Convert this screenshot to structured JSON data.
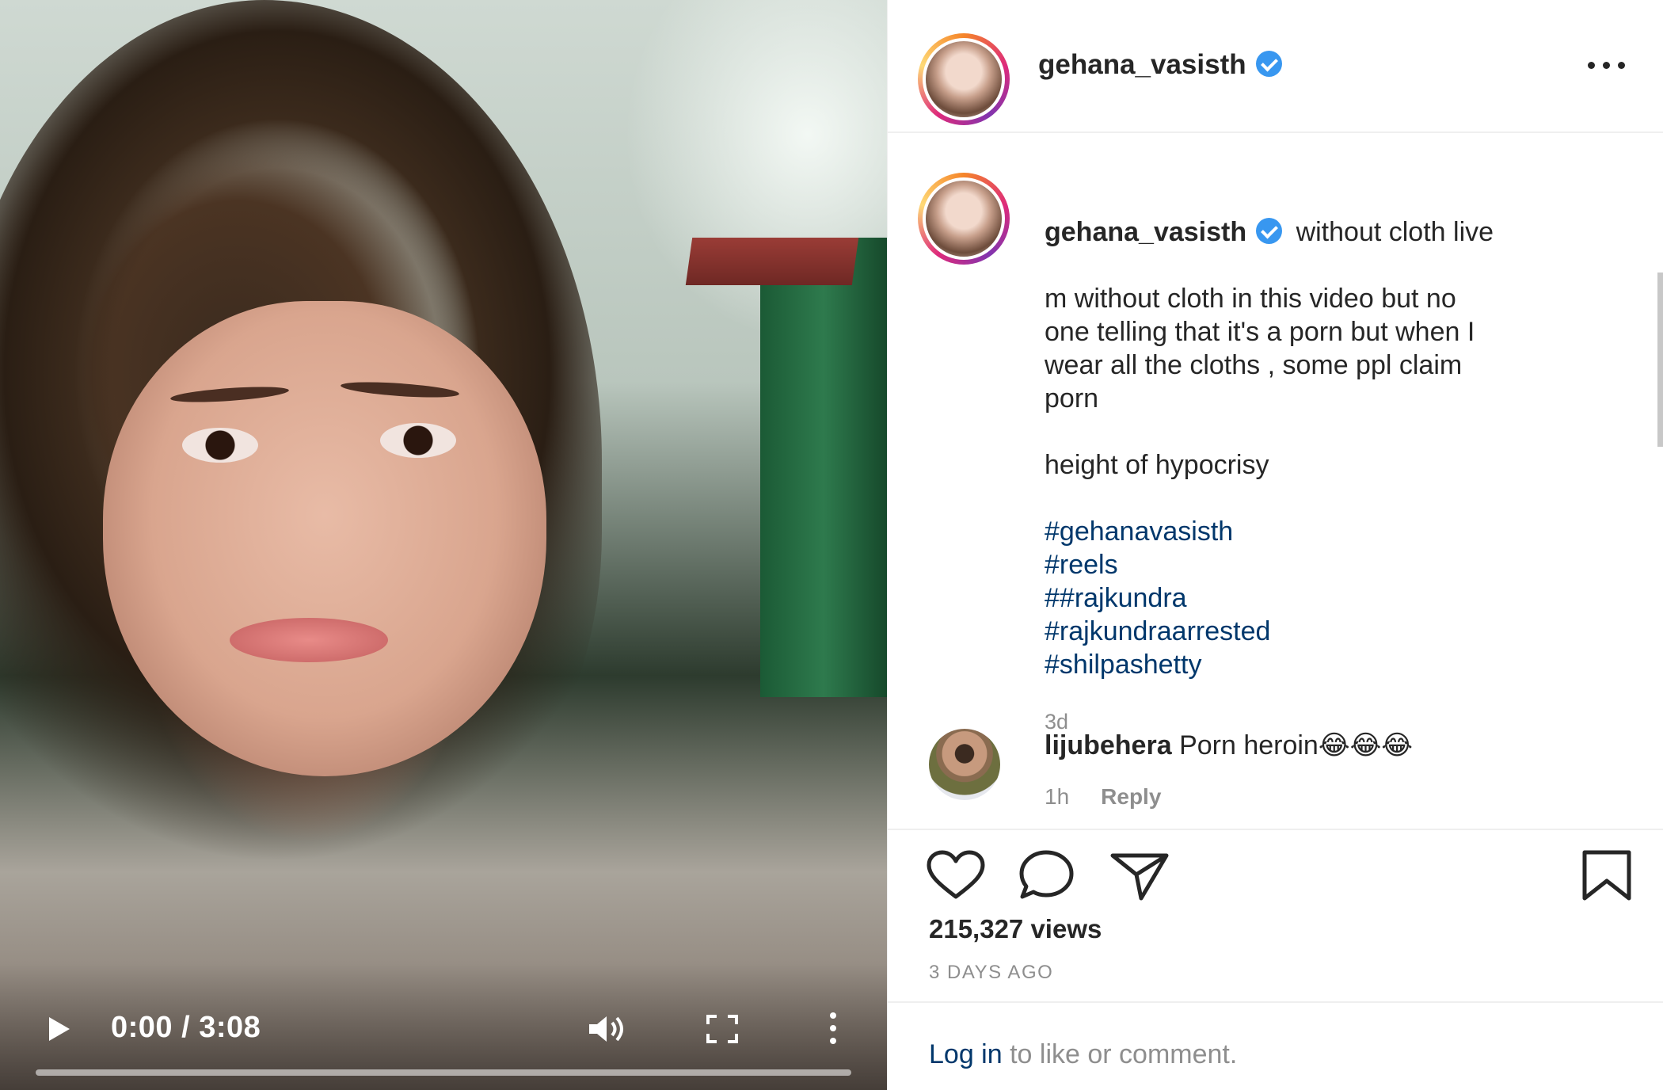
{
  "video": {
    "current_time": "0:00",
    "duration": "3:08",
    "time_display": "0:00 / 3:08",
    "progress": 0.0
  },
  "header": {
    "username": "gehana_vasisth",
    "verified": true
  },
  "caption": {
    "username": "gehana_vasisth",
    "title_text": "without cloth live",
    "body_line1": "m without cloth in this video but no",
    "body_line2": "one telling that it's a porn but when I",
    "body_line3": "wear all the cloths , some ppl claim",
    "body_line4": "porn",
    "tagline": "height of hypocrisy",
    "hashtags": [
      "#gehanavasisth",
      "#reels",
      "##rajkundra",
      "#rajkundraarrested",
      "#shilpashetty"
    ],
    "time": "3d"
  },
  "comment": {
    "username": "lijubehera",
    "text": "Porn heroin😂😂😂",
    "time": "1h",
    "reply_label": "Reply"
  },
  "stats": {
    "views": "215,327 views",
    "posted": "3 DAYS AGO"
  },
  "login": {
    "link_text": "Log in",
    "rest_text": " to like or comment."
  },
  "icons": [
    "play-icon",
    "volume-icon",
    "fullscreen-icon",
    "more-vertical-icon",
    "more-horizontal-icon",
    "verified-badge-icon",
    "heart-icon",
    "comment-icon",
    "share-icon",
    "bookmark-icon"
  ],
  "colors": {
    "link": "#00376b",
    "verified": "#3897f0",
    "muted": "#8e8e8e",
    "text": "#262626"
  }
}
